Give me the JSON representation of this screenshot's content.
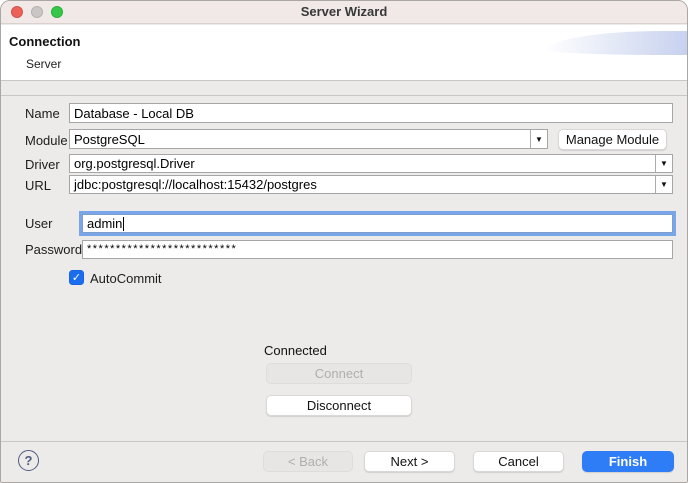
{
  "window": {
    "title": "Server Wizard"
  },
  "header": {
    "title": "Connection",
    "subtitle": "Server"
  },
  "form": {
    "name": {
      "label": "Name",
      "value": "Database - Local DB"
    },
    "module": {
      "label": "Module",
      "value": "PostgreSQL",
      "manage_button": "Manage Module"
    },
    "driver": {
      "label": "Driver",
      "value": "org.postgresql.Driver"
    },
    "url": {
      "label": "URL",
      "value": "jdbc:postgresql://localhost:15432/postgres"
    },
    "user": {
      "label": "User",
      "value": "admin"
    },
    "password": {
      "label": "Password",
      "value": "**************************"
    },
    "autocommit": {
      "label": "AutoCommit",
      "checked": true
    }
  },
  "connection": {
    "status": "Connected",
    "connect_button": "Connect",
    "disconnect_button": "Disconnect"
  },
  "footer": {
    "back_button": "< Back",
    "next_button": "Next >",
    "cancel_button": "Cancel",
    "finish_button": "Finish"
  },
  "icons": {
    "dropdown": "▼",
    "help": "?",
    "check": "✓"
  },
  "colors": {
    "accent": "#2E7CF6",
    "focus": "#79A5E9",
    "checkbox": "#1A6DEE",
    "trafficRed": "#EC6259",
    "trafficGray": "#C9C6C5",
    "trafficGreen": "#34C748"
  }
}
